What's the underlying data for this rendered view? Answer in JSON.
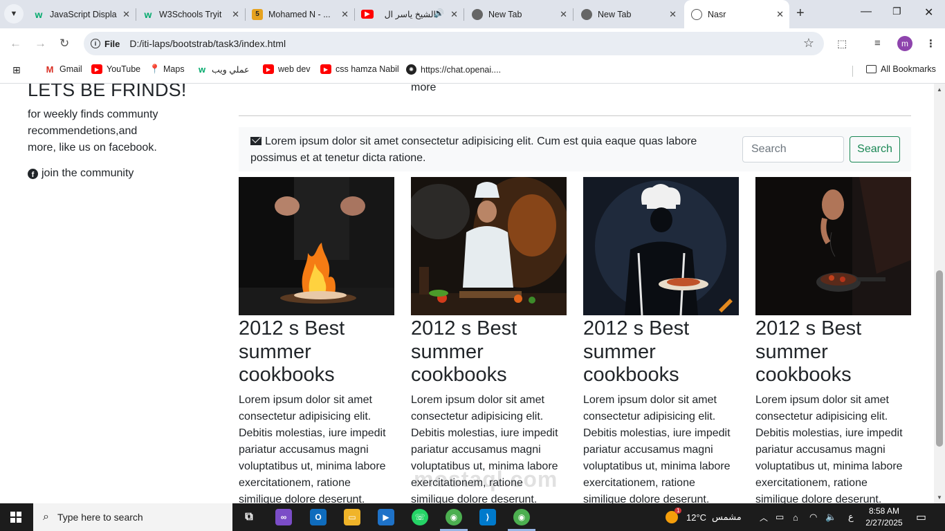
{
  "browser": {
    "tabs": [
      {
        "title": "JavaScript Displa",
        "favicon": "w3schools-icon",
        "color": "#04aa6d"
      },
      {
        "title": "W3Schools Tryit",
        "favicon": "w3schools-icon",
        "color": "#04aa6d"
      },
      {
        "title": "Mohamed N - ...",
        "favicon": "html5-icon",
        "color": "#e6a21f"
      },
      {
        "title": "الشيخ ياسر ال",
        "favicon": "youtube-icon",
        "color": "#ff0000"
      },
      {
        "title": "New Tab",
        "favicon": "chrome-icon",
        "color": "#555555"
      },
      {
        "title": "New Tab",
        "favicon": "chrome-icon",
        "color": "#555555"
      },
      {
        "title": "Nasr",
        "favicon": "globe-icon",
        "color": "#555555"
      }
    ],
    "address": {
      "scheme_label": "File",
      "url": "D:/iti-laps/bootstrab/task3/index.html"
    },
    "profile_initial": "m",
    "bookmarks": [
      {
        "label": "Gmail",
        "icon": "gmail-icon",
        "color": "#d93025"
      },
      {
        "label": "YouTube",
        "icon": "youtube-icon",
        "color": "#ff0000"
      },
      {
        "label": "Maps",
        "icon": "maps-icon",
        "color": "#34a853"
      },
      {
        "label": "عملي ويب",
        "icon": "w3schools-icon",
        "color": "#04aa6d"
      },
      {
        "label": "web dev",
        "icon": "youtube-icon",
        "color": "#ff0000"
      },
      {
        "label": "css hamza Nabil",
        "icon": "youtube-icon",
        "color": "#ff0000"
      },
      {
        "label": "https://chat.openai....",
        "icon": "openai-icon",
        "color": "#222222"
      }
    ],
    "all_bookmarks": "All Bookmarks"
  },
  "page": {
    "sidebar": {
      "title": "LETS BE FRINDS!",
      "text": "for weekly finds communty recommendetions,and more, like us on facebook.",
      "join": "join the community"
    },
    "more_text": "more",
    "alert": {
      "text": "Lorem ipsum dolor sit amet consectetur adipisicing elit. Cum est quia eaque quas labore possimus et at tenetur dicta ratione."
    },
    "search": {
      "placeholder": "Search",
      "button": "Search"
    },
    "cards": [
      {
        "title": "2012 s Best summer cookbooks",
        "text": "Lorem ipsum dolor sit amet consectetur adipisicing elit. Debitis molestias, iure impedit pariatur accusamus magni voluptatibus ut, minima labore exercitationem, ratione similique dolore deserunt."
      },
      {
        "title": "2012 s Best summer cookbooks",
        "text": "Lorem ipsum dolor sit amet consectetur adipisicing elit. Debitis molestias, iure impedit pariatur accusamus magni voluptatibus ut, minima labore exercitationem, ratione similique dolore deserunt."
      },
      {
        "title": "2012 s Best summer cookbooks",
        "text": "Lorem ipsum dolor sit amet consectetur adipisicing elit. Debitis molestias, iure impedit pariatur accusamus magni voluptatibus ut, minima labore exercitationem, ratione similique dolore deserunt."
      },
      {
        "title": "2012 s Best summer cookbooks",
        "text": "Lorem ipsum dolor sit amet consectetur adipisicing elit. Debitis molestias, iure impedit pariatur accusamus magni voluptatibus ut, minima labore exercitationem, ratione similique dolore deserunt."
      }
    ],
    "watermark": "mostaql.com"
  },
  "taskbar": {
    "search_placeholder": "Type here to search",
    "weather": {
      "temp": "12°C",
      "condition": "مشمس",
      "badge": "1"
    },
    "lang": "ع",
    "time": "8:58 AM",
    "date": "2/27/2025"
  }
}
